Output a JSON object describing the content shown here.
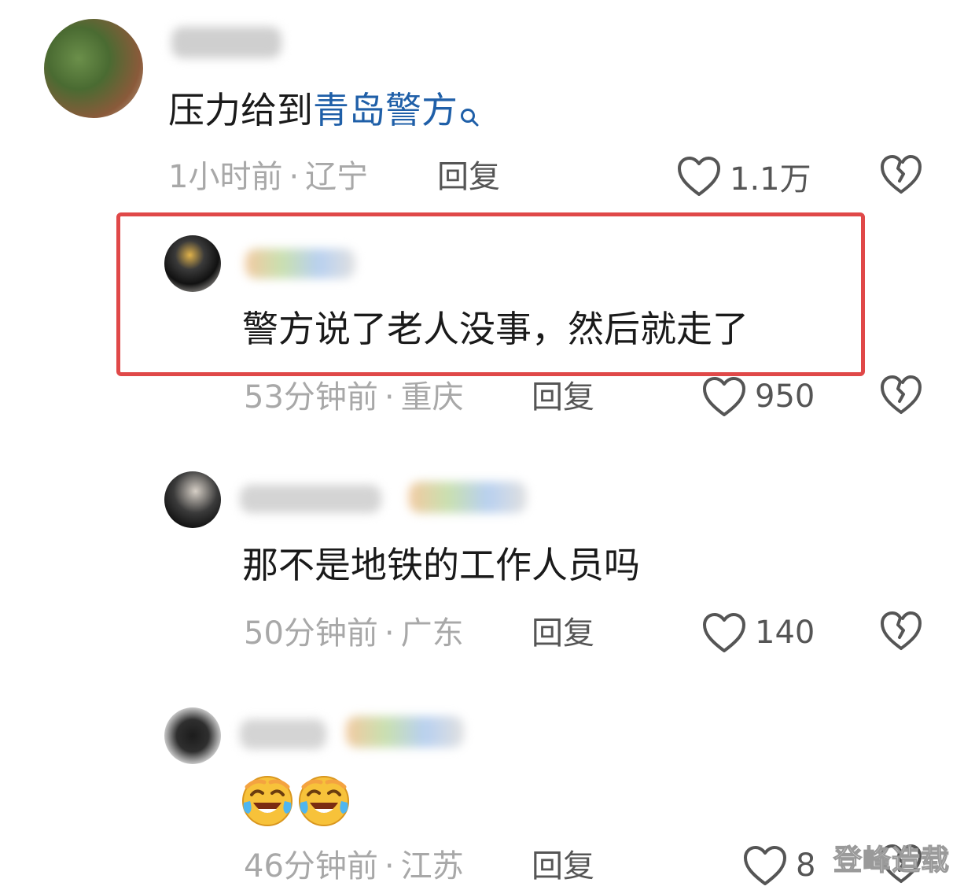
{
  "comments": [
    {
      "text_prefix": "压力给到",
      "link_text": "青岛警方",
      "time": "1小时前",
      "location": "辽宁",
      "reply_label": "回复",
      "likes": "1.1万"
    }
  ],
  "replies": [
    {
      "text": "警方说了老人没事，然后就走了",
      "time": "53分钟前",
      "location": "重庆",
      "reply_label": "回复",
      "likes": "950"
    },
    {
      "text": "那不是地铁的工作人员吗",
      "time": "50分钟前",
      "location": "广东",
      "reply_label": "回复",
      "likes": "140"
    },
    {
      "emojis": [
        "laughing-crying-emoji",
        "laughing-crying-emoji"
      ],
      "time": "46分钟前",
      "location": "江苏",
      "reply_label": "回复",
      "likes": "8"
    }
  ],
  "separator": "·",
  "watermark": "登峰造载",
  "colors": {
    "link": "#1f5fa8",
    "highlight_border": "#e04848",
    "meta_text": "#a8a8a8",
    "action_text": "#555555"
  }
}
